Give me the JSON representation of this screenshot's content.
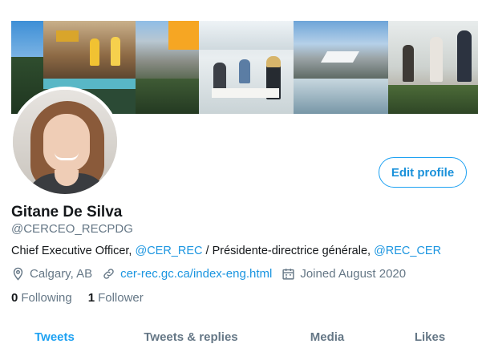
{
  "profile": {
    "name": "Gitane De Silva",
    "handle": "@CERCEO_RECPDG",
    "edit_label": "Edit profile",
    "bio": {
      "part1": "Chief Executive Officer, ",
      "mention1": "@CER_REC",
      "part2": " / Présidente-directrice générale, ",
      "mention2": "@REC_CER"
    },
    "location": "Calgary, AB",
    "link": "cer-rec.gc.ca/index-eng.html",
    "joined": "Joined August 2020",
    "following_count": "0",
    "following_label": "Following",
    "followers_count": "1",
    "followers_label": "Follower"
  },
  "tabs": [
    {
      "label": "Tweets",
      "active": true
    },
    {
      "label": "Tweets & replies",
      "active": false
    },
    {
      "label": "Media",
      "active": false
    },
    {
      "label": "Likes",
      "active": false
    }
  ],
  "colors": {
    "accent": "#1da1f2",
    "link": "#1b95e0",
    "secondary_text": "#657786"
  },
  "icons": {
    "location": "location-pin-icon",
    "link": "link-icon",
    "calendar": "calendar-icon"
  }
}
